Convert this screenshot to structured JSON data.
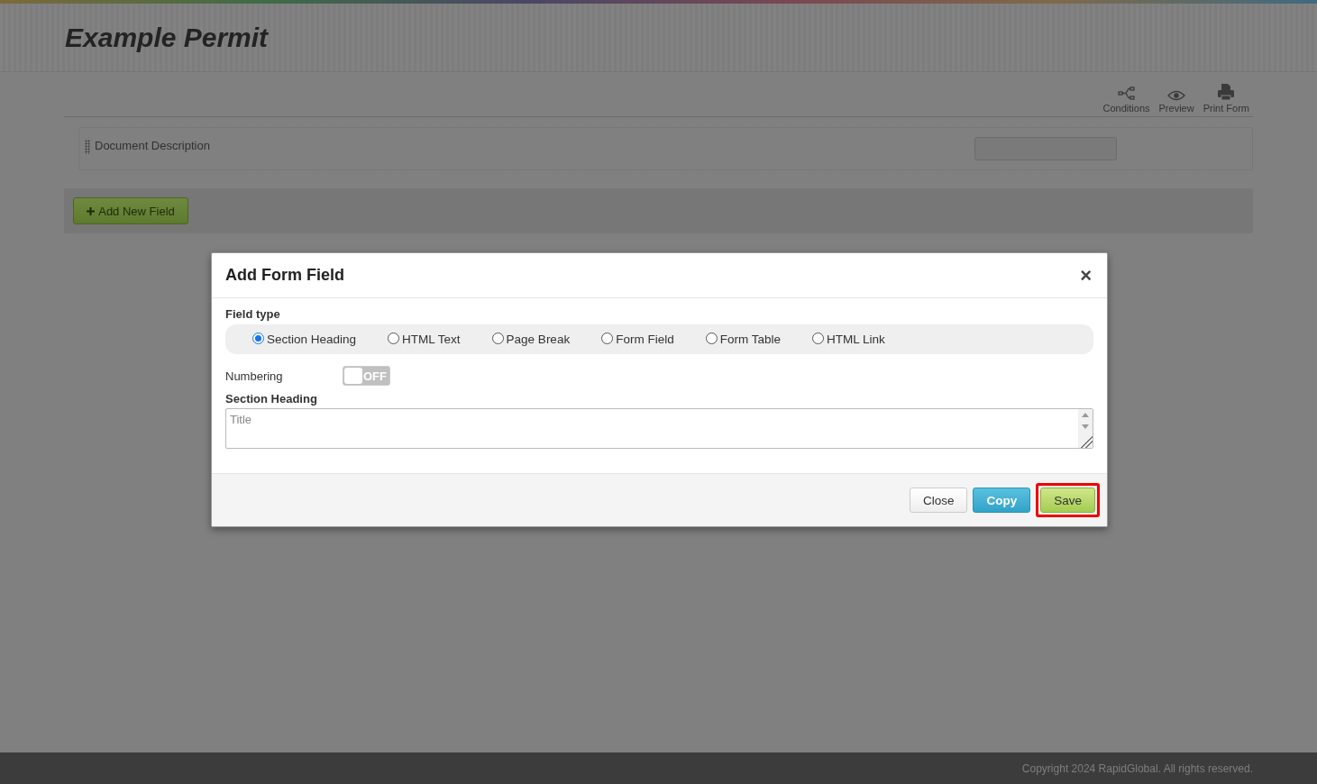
{
  "page": {
    "title": "Example Permit"
  },
  "toolbar": [
    {
      "kind": "conditions",
      "label": "Conditions"
    },
    {
      "kind": "preview",
      "label": "Preview"
    },
    {
      "kind": "print",
      "label": "Print Form"
    }
  ],
  "document_description": {
    "label": "Document Description"
  },
  "add_field_button": {
    "label": "Add New Field"
  },
  "dialog": {
    "title": "Add Form Field",
    "close_symbol": "×",
    "field_type": {
      "label": "Field type",
      "options": [
        {
          "label": "Section Heading",
          "selected": true
        },
        {
          "label": "HTML Text",
          "selected": false
        },
        {
          "label": "Page Break",
          "selected": false
        },
        {
          "label": "Form Field",
          "selected": false
        },
        {
          "label": "Form Table",
          "selected": false
        },
        {
          "label": "HTML Link",
          "selected": false
        }
      ]
    },
    "numbering": {
      "label": "Numbering",
      "on": false,
      "state_text": "OFF"
    },
    "section_heading": {
      "label": "Section Heading",
      "placeholder": "Title"
    },
    "buttons": [
      {
        "kind": "default",
        "label": "Close",
        "highlighted": false
      },
      {
        "kind": "info",
        "label": "Copy",
        "highlighted": false
      },
      {
        "kind": "success",
        "label": "Save",
        "highlighted": true
      }
    ]
  },
  "footer": {
    "text": "Copyright 2024 RapidGlobal. All rights reserved."
  }
}
